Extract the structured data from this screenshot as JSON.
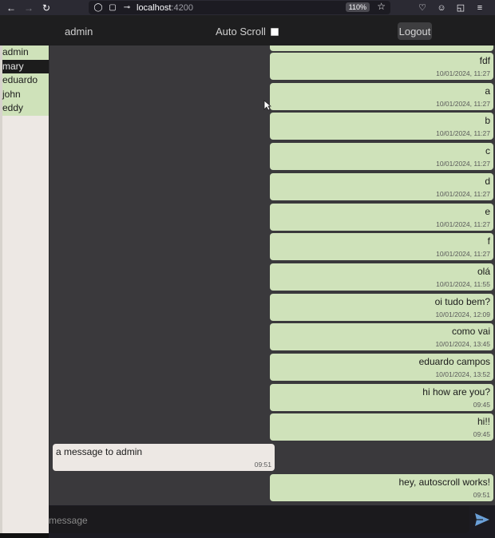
{
  "browser": {
    "url_host": "localhost",
    "url_port": ":4200",
    "zoom": "110%"
  },
  "header": {
    "current_user": "admin",
    "autoscroll_label": "Auto Scroll",
    "autoscroll_checked": false,
    "logout_label": "Logout"
  },
  "sidebar": {
    "users": [
      "admin",
      "mary",
      "eduardo",
      "john",
      "eddy"
    ],
    "selected": "mary"
  },
  "messages": [
    {
      "text": "fdf",
      "time": "10/01/2024, 11:27",
      "mine": true
    },
    {
      "text": "a",
      "time": "10/01/2024, 11:27",
      "mine": true
    },
    {
      "text": "b",
      "time": "10/01/2024, 11:27",
      "mine": true
    },
    {
      "text": "c",
      "time": "10/01/2024, 11:27",
      "mine": true
    },
    {
      "text": "d",
      "time": "10/01/2024, 11:27",
      "mine": true
    },
    {
      "text": "e",
      "time": "10/01/2024, 11:27",
      "mine": true
    },
    {
      "text": "f",
      "time": "10/01/2024, 11:27",
      "mine": true
    },
    {
      "text": "olá",
      "time": "10/01/2024, 11:55",
      "mine": true
    },
    {
      "text": "oi tudo bem?",
      "time": "10/01/2024, 12:09",
      "mine": true
    },
    {
      "text": "como vai",
      "time": "10/01/2024, 13:45",
      "mine": true
    },
    {
      "text": "eduardo campos",
      "time": "10/01/2024, 13:52",
      "mine": true
    },
    {
      "text": "hi how are you?",
      "time": "09:45",
      "mine": true
    },
    {
      "text": "hi!!",
      "time": "09:45",
      "mine": true
    },
    {
      "text": "a message to admin",
      "time": "09:51",
      "mine": false
    },
    {
      "text": "hey, autoscroll works!",
      "time": "09:51",
      "mine": true
    }
  ],
  "composer": {
    "placeholder": "message"
  },
  "colors": {
    "mine_bubble": "#cfe2ba",
    "their_bubble": "#ede8e4",
    "chat_bg": "#3a393c",
    "send_icon": "#6a9fd8"
  }
}
